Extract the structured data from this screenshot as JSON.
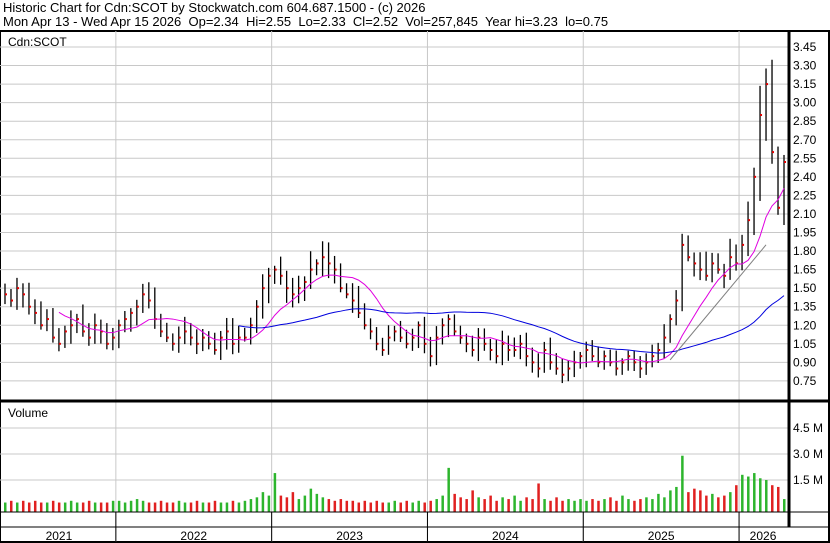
{
  "header": {
    "title": "Historic Chart for Cdn:SCOT by Stockwatch.com 604.687.1500 - (c) 2026",
    "summary": "Mon Apr 13 - Wed Apr 15 2026  Op=2.34  Hi=2.55  Lo=2.33  Cl=2.52  Vol=257,845  Year hi=3.23  lo=0.75"
  },
  "chart_data": {
    "type": "ohlc",
    "symbol_label": "Cdn:SCOT",
    "volume_label": "Volume",
    "price_ticks": [
      3.45,
      3.3,
      3.15,
      3.0,
      2.85,
      2.7,
      2.55,
      2.4,
      2.25,
      2.1,
      1.95,
      1.8,
      1.65,
      1.5,
      1.35,
      1.2,
      1.05,
      0.9,
      0.75
    ],
    "price_range": [
      0.66,
      3.55
    ],
    "volume_ticks": [
      {
        "v": 4.5,
        "label": "4.5 M"
      },
      {
        "v": 3.0,
        "label": "3.0 M"
      },
      {
        "v": 1.5,
        "label": "1.5 M"
      }
    ],
    "volume_max": 5.6,
    "years": [
      "2021",
      "2022",
      "2023",
      "2024",
      "2025",
      "2026"
    ],
    "year_bar_counts": [
      19,
      26,
      26,
      26,
      26,
      8
    ],
    "closes": [
      1.45,
      1.4,
      1.5,
      1.45,
      1.35,
      1.3,
      1.2,
      1.25,
      1.1,
      1.05,
      1.15,
      1.2,
      1.25,
      1.15,
      1.1,
      1.2,
      1.15,
      1.05,
      1.1,
      1.2,
      1.25,
      1.3,
      1.35,
      1.45,
      1.4,
      1.25,
      1.15,
      1.1,
      1.05,
      1.1,
      1.15,
      1.1,
      1.05,
      1.1,
      1.05,
      1.0,
      1.1,
      1.15,
      1.05,
      1.1,
      1.1,
      1.2,
      1.35,
      1.5,
      1.6,
      1.65,
      1.6,
      1.5,
      1.45,
      1.5,
      1.55,
      1.65,
      1.7,
      1.75,
      1.7,
      1.65,
      1.5,
      1.45,
      1.4,
      1.3,
      1.2,
      1.15,
      1.05,
      1.0,
      1.1,
      1.15,
      1.1,
      1.05,
      1.1,
      1.2,
      1.05,
      0.95,
      1.1,
      1.2,
      1.25,
      1.15,
      1.1,
      1.05,
      1.0,
      1.1,
      1.05,
      1.0,
      0.95,
      1.05,
      1.0,
      1.0,
      1.05,
      0.95,
      0.9,
      0.85,
      1.0,
      0.9,
      0.85,
      0.8,
      0.85,
      0.9,
      0.95,
      1.0,
      0.95,
      0.9,
      0.95,
      0.9,
      0.85,
      0.9,
      0.95,
      0.9,
      0.85,
      0.9,
      0.95,
      1.0,
      1.1,
      1.25,
      1.4,
      1.85,
      1.75,
      1.7,
      1.65,
      1.6,
      1.7,
      1.65,
      1.6,
      1.75,
      1.7,
      1.85,
      2.05,
      2.4,
      2.9,
      3.15,
      2.6,
      2.15,
      2.52
    ],
    "volumes_m": [
      0.2,
      0.3,
      0.2,
      0.3,
      0.2,
      0.3,
      0.2,
      0.2,
      0.3,
      0.2,
      0.2,
      0.3,
      0.2,
      0.2,
      0.3,
      0.2,
      0.2,
      0.2,
      0.3,
      0.3,
      0.2,
      0.3,
      0.4,
      0.3,
      0.2,
      0.2,
      0.3,
      0.2,
      0.2,
      0.3,
      0.2,
      0.2,
      0.3,
      0.2,
      0.2,
      0.3,
      0.2,
      0.2,
      0.3,
      0.2,
      0.3,
      0.4,
      0.5,
      0.8,
      0.6,
      1.9,
      0.6,
      0.5,
      0.8,
      0.4,
      0.6,
      1.0,
      0.7,
      0.5,
      0.4,
      0.3,
      0.4,
      0.3,
      0.3,
      0.2,
      0.3,
      0.2,
      0.3,
      0.2,
      0.2,
      0.3,
      0.2,
      0.3,
      0.2,
      0.3,
      0.2,
      0.3,
      0.4,
      0.6,
      2.2,
      0.7,
      0.5,
      0.4,
      0.9,
      0.5,
      0.4,
      0.6,
      0.3,
      0.5,
      0.4,
      0.6,
      0.3,
      0.5,
      0.4,
      1.3,
      0.4,
      0.3,
      0.5,
      0.3,
      0.4,
      0.3,
      0.4,
      0.3,
      0.4,
      0.3,
      0.4,
      0.5,
      0.3,
      0.6,
      0.4,
      0.3,
      0.4,
      0.5,
      0.4,
      0.7,
      0.5,
      0.9,
      1.1,
      2.9,
      0.8,
      1.0,
      0.9,
      0.6,
      0.7,
      0.5,
      0.6,
      0.8,
      1.2,
      1.8,
      1.7,
      1.9,
      1.6,
      1.5,
      1.2,
      1.1,
      0.4
    ]
  }
}
